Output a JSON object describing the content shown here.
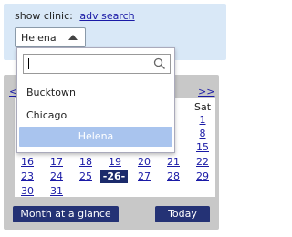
{
  "clinic": {
    "label": "show clinic:",
    "adv_search": "adv search",
    "selected": "Helena"
  },
  "dropdown": {
    "search_value": "",
    "options": [
      "Bucktown",
      "Chicago",
      "Helena"
    ]
  },
  "calendar": {
    "prev": "<<",
    "next": ">>",
    "dow_sat": "Sat",
    "days": {
      "d1": "1",
      "d8": "8",
      "d15": "15",
      "d16": "16",
      "d17": "17",
      "d18": "18",
      "d19": "19",
      "d20": "20",
      "d21": "21",
      "d22": "22",
      "d23": "23",
      "d24": "24",
      "d25": "25",
      "d26": "-26-",
      "d27": "27",
      "d28": "28",
      "d29": "29",
      "d30": "30",
      "d31": "31"
    },
    "month_button": "Month at a glance",
    "today_button": "Today"
  },
  "colors": {
    "panel_top": "#d9e8f7",
    "panel_cal": "#c8c8c8",
    "button_bg": "#243275",
    "today_cell": "#1b2a6b",
    "selected_option": "#a9c4ee",
    "link": "#1a1aa6"
  }
}
